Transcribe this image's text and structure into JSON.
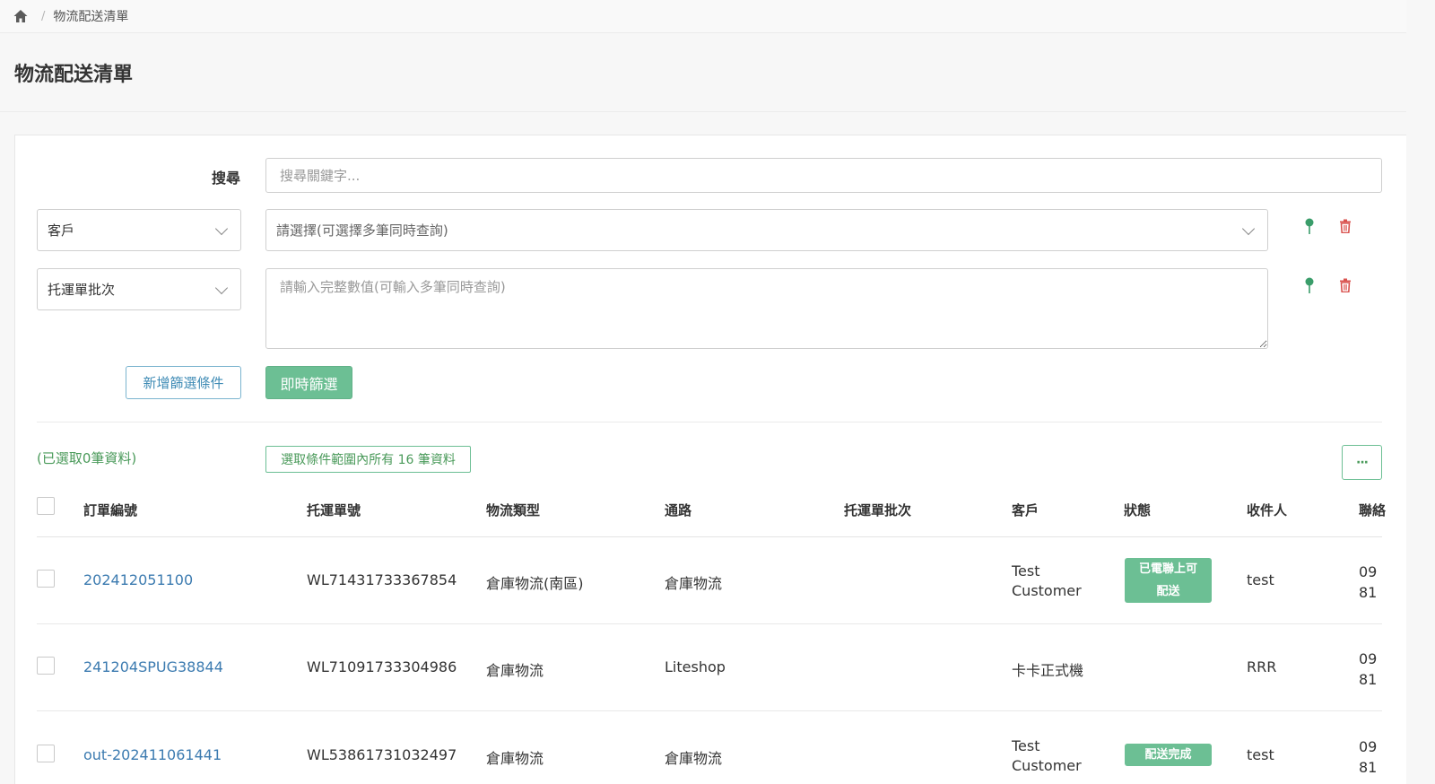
{
  "breadcrumb": {
    "current": "物流配送清單"
  },
  "page": {
    "title": "物流配送清單"
  },
  "filters": {
    "search_label": "搜尋",
    "search_placeholder": "搜尋關鍵字...",
    "rows": [
      {
        "field": "客戶",
        "value_placeholder": "請選擇(可選擇多筆同時查詢)"
      },
      {
        "field": "托運單批次",
        "value_placeholder": "請輸入完整數值(可輸入多筆同時查詢)"
      }
    ],
    "add_condition_label": "新增篩選條件",
    "apply_label": "即時篩選"
  },
  "selection": {
    "selected_text": "(已選取0筆資料)",
    "select_all_text": "選取條件範圍內所有 16 筆資料",
    "more_label": "···"
  },
  "table": {
    "columns": [
      "訂單編號",
      "托運單號",
      "物流類型",
      "通路",
      "托運單批次",
      "客戶",
      "狀態",
      "收件人",
      "聯絡"
    ],
    "rows": [
      {
        "order_no": "202412051100",
        "waybill": "WL71431733367854",
        "type": "倉庫物流(南區)",
        "channel": "倉庫物流",
        "batch": "",
        "customer": "Test Customer",
        "status": "已電聯上可配送",
        "recipient": "test",
        "phone": "0981"
      },
      {
        "order_no": "241204SPUG38844",
        "waybill": "WL71091733304986",
        "type": "倉庫物流",
        "channel": "Liteshop",
        "batch": "",
        "customer": "卡卡正式機",
        "status": "",
        "recipient": "RRR",
        "phone": "0981"
      },
      {
        "order_no": "out-202411061441",
        "waybill": "WL53861731032497",
        "type": "倉庫物流",
        "channel": "倉庫物流",
        "batch": "",
        "customer": "Test Customer",
        "status": "配送完成",
        "recipient": "test",
        "phone": "0981"
      }
    ]
  },
  "colors": {
    "accent_green": "#6cbf94",
    "link_blue": "#3c7bb0",
    "danger_red": "#d9534f",
    "pin_green": "#3a9d6a"
  }
}
